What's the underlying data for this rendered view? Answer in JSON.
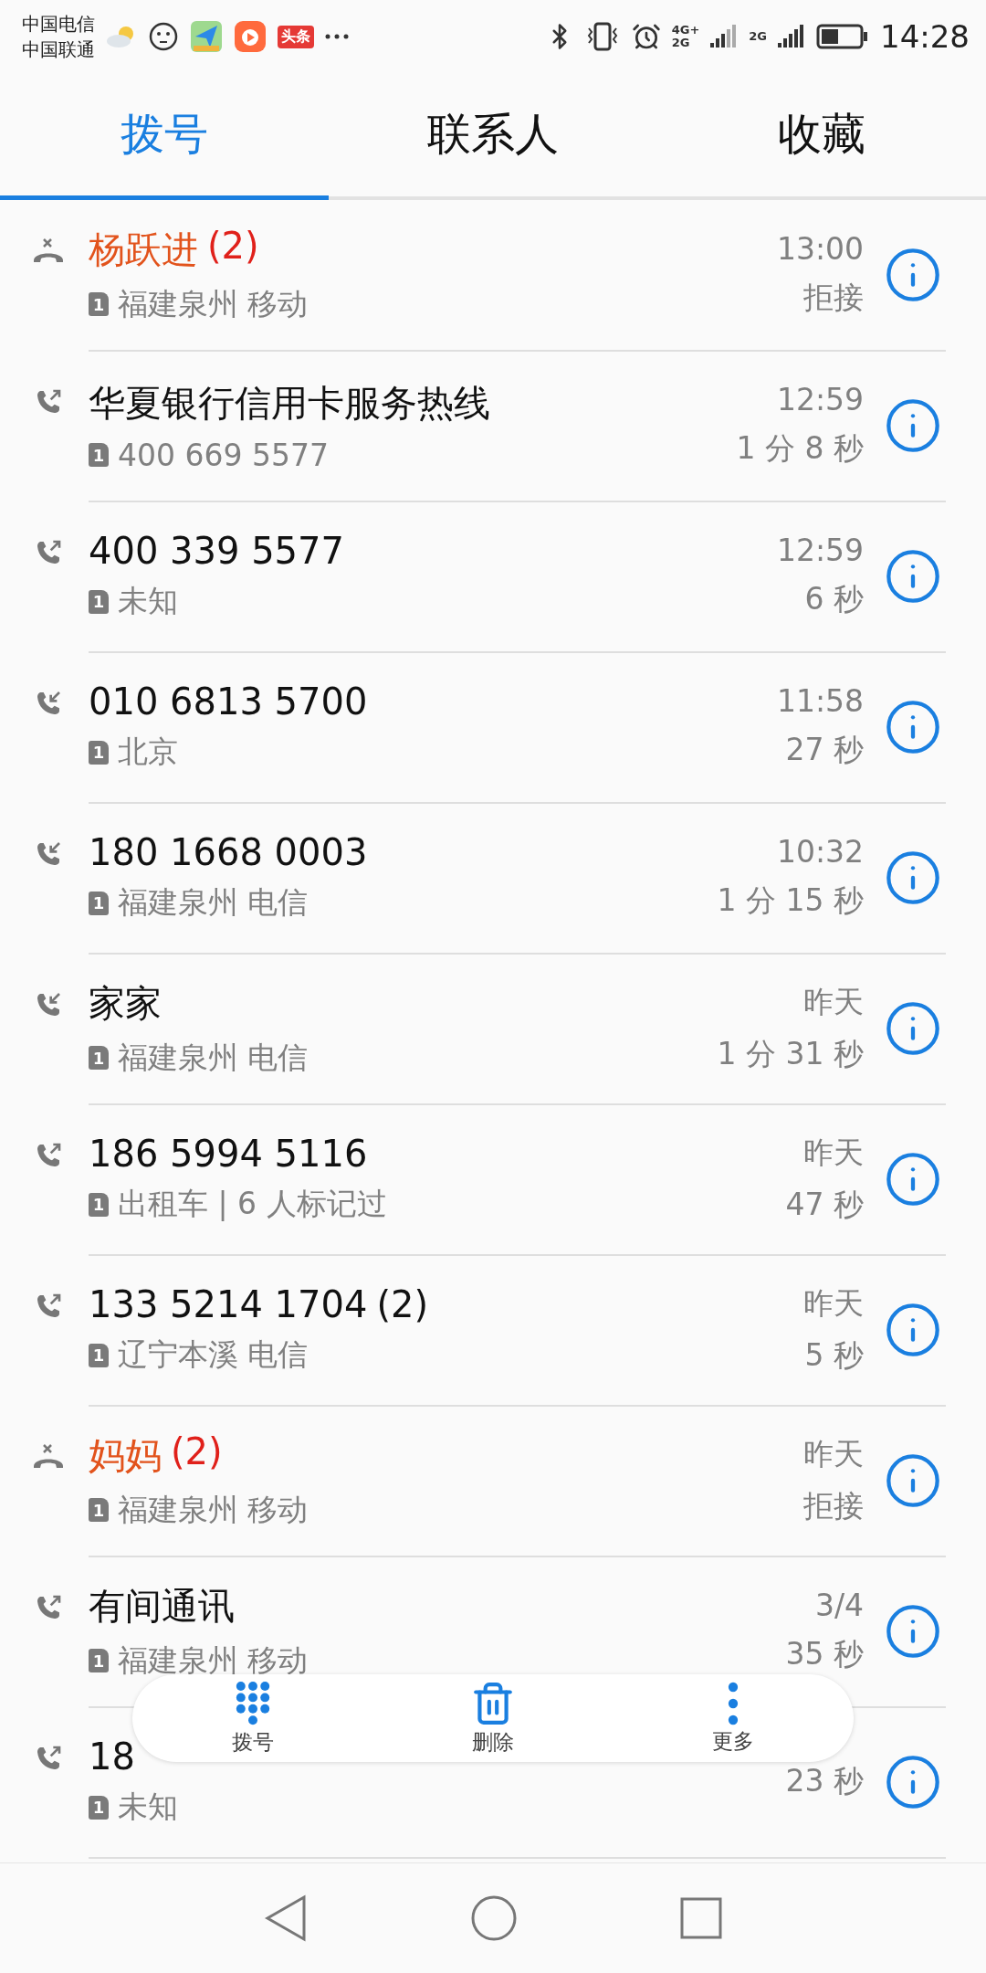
{
  "status_bar": {
    "carriers": [
      "中国电信",
      "中国联通"
    ],
    "app_badge": "头条",
    "network_labels": [
      "4G+",
      "2G",
      "2G"
    ],
    "time": "14:28"
  },
  "tabs": [
    {
      "label": "拨号",
      "selected": true
    },
    {
      "label": "联系人",
      "selected": false
    },
    {
      "label": "收藏",
      "selected": false
    }
  ],
  "calls": [
    {
      "kind": "rejected",
      "name": "杨跃进",
      "count": "(2)",
      "sim": "1",
      "location": "福建泉州 移动",
      "time": "13:00",
      "duration": "拒接"
    },
    {
      "kind": "outgoing",
      "name": "华夏银行信用卡服务热线",
      "sim": "1",
      "location": "400 669 5577",
      "time": "12:59",
      "duration": "1 分 8 秒"
    },
    {
      "kind": "outgoing",
      "name": "400 339 5577",
      "sim": "1",
      "location": "未知",
      "time": "12:59",
      "duration": "6 秒"
    },
    {
      "kind": "incoming",
      "name": "010 6813 5700",
      "sim": "1",
      "location": "北京",
      "time": "11:58",
      "duration": "27 秒"
    },
    {
      "kind": "incoming",
      "name": "180 1668 0003",
      "sim": "1",
      "location": "福建泉州 电信",
      "time": "10:32",
      "duration": "1 分 15 秒"
    },
    {
      "kind": "incoming",
      "name": "家家",
      "sim": "1",
      "location": "福建泉州 电信",
      "time": "昨天",
      "duration": "1 分 31 秒"
    },
    {
      "kind": "outgoing",
      "name": "186 5994 5116",
      "sim": "1",
      "location": "出租车 | 6 人标记过",
      "time": "昨天",
      "duration": "47 秒"
    },
    {
      "kind": "outgoing",
      "name": "133 5214 1704",
      "count": "(2)",
      "sim": "1",
      "location": "辽宁本溪 电信",
      "time": "昨天",
      "duration": "5 秒"
    },
    {
      "kind": "rejected",
      "name": "妈妈",
      "count": "(2)",
      "sim": "1",
      "location": "福建泉州 移动",
      "time": "昨天",
      "duration": "拒接"
    },
    {
      "kind": "outgoing",
      "name": "有间通讯",
      "sim": "1",
      "location": "福建泉州 移动",
      "time": "3/4",
      "duration": "35 秒"
    },
    {
      "kind": "outgoing",
      "name": "18",
      "sim": "1",
      "location": "未知",
      "duration": "23 秒"
    }
  ],
  "toolbar": [
    {
      "kind": "dialpad",
      "label": "拨号"
    },
    {
      "kind": "delete",
      "label": "删除"
    },
    {
      "kind": "more",
      "label": "更多"
    }
  ]
}
